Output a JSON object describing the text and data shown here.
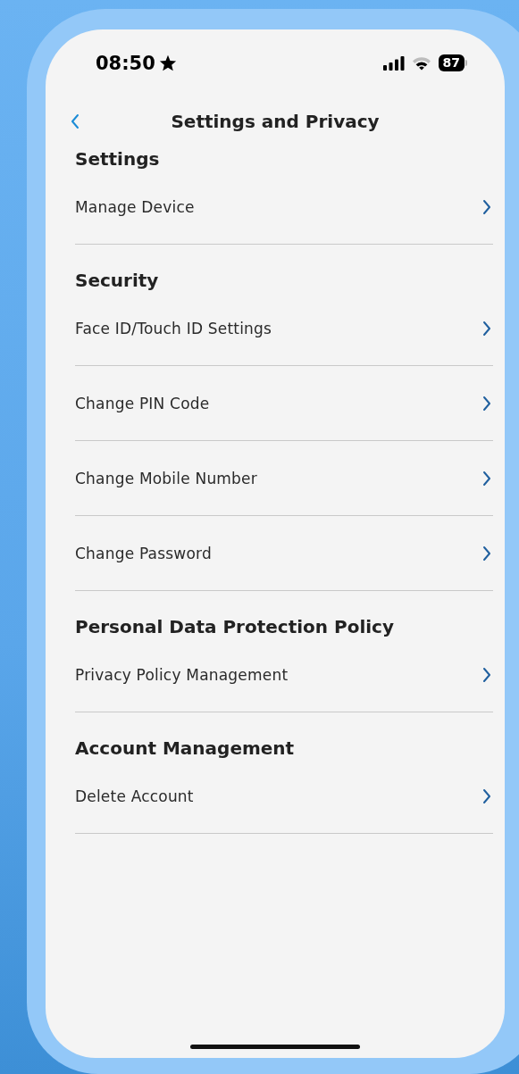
{
  "status_bar": {
    "time": "08:50",
    "battery": "87"
  },
  "nav": {
    "title": "Settings and Privacy"
  },
  "sections": [
    {
      "heading": "Settings",
      "items": [
        {
          "label": "Manage Device"
        }
      ]
    },
    {
      "heading": "Security",
      "items": [
        {
          "label": "Face ID/Touch ID Settings"
        },
        {
          "label": "Change PIN Code"
        },
        {
          "label": "Change Mobile Number"
        },
        {
          "label": "Change Password"
        }
      ]
    },
    {
      "heading": "Personal Data Protection Policy",
      "items": [
        {
          "label": "Privacy Policy Management"
        }
      ]
    },
    {
      "heading": "Account Management",
      "items": [
        {
          "label": "Delete Account"
        }
      ]
    }
  ]
}
